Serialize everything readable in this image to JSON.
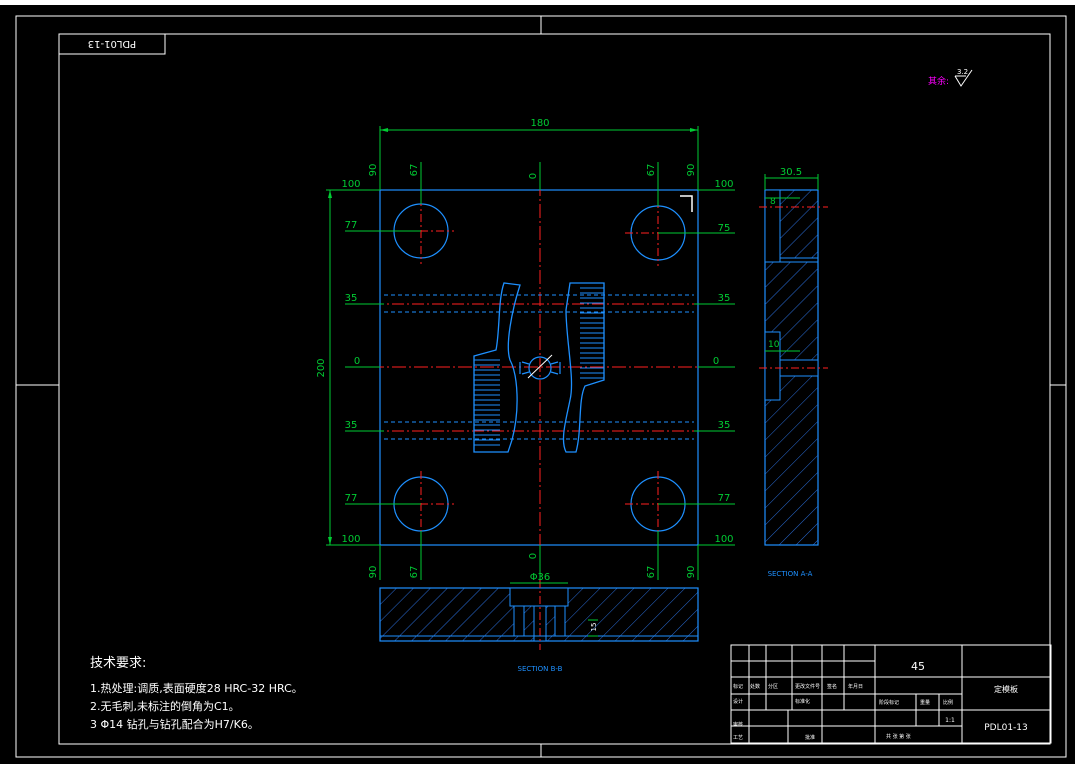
{
  "drawing_number_tag": "PDL01-13",
  "roughness_note": {
    "label": "其余:",
    "value": "3.2"
  },
  "dimensions": {
    "overall_width": "180",
    "overall_height": "200",
    "top_left_outer": "90",
    "top_left_inner": "67",
    "top_center": "0",
    "top_right_inner": "67",
    "top_right_outer": "90",
    "bottom_center_dia": "Φ36",
    "left_rows": [
      "100",
      "77",
      "35",
      "0",
      "35",
      "77",
      "100"
    ],
    "right_rows": [
      "100",
      "75",
      "35",
      "0",
      "35",
      "77",
      "100"
    ],
    "bottom_left_outer": "90",
    "bottom_left_inner": "67",
    "bottom_center": "0",
    "bottom_right_inner": "67",
    "bottom_right_outer": "90",
    "section_width": "30.5",
    "section_top_offset": "8",
    "section_gate": "10",
    "section_bb_depth": "15"
  },
  "section_labels": {
    "aa": "SECTION A-A",
    "bb": "SECTION B-B"
  },
  "tech_requirements": {
    "title": "技术要求:",
    "items": [
      "1.热处理:调质,表面硬度28 HRC-32 HRC。",
      "2.无毛刺,未标注的倒角为C1。",
      "3 Φ14 钻孔与钻孔配合为H7/K6。"
    ]
  },
  "title_block": {
    "material": "45",
    "part_name": "定模板",
    "drawing_number": "PDL01-13",
    "scale": "1:1",
    "small_labels": [
      "标记",
      "处数",
      "分区",
      "更改文件号",
      "签名",
      "年月日",
      "设计",
      "标准化",
      "审核",
      "工艺",
      "批准",
      "阶段标记",
      "重量",
      "比例",
      "共 张 第 张"
    ]
  },
  "colors": {
    "border": "#ffffff",
    "part": "#1e90ff",
    "dimension": "#00cc33",
    "centerline": "#ff2020",
    "hatch": "#2a6dd8",
    "magenta": "#ff00ff"
  }
}
